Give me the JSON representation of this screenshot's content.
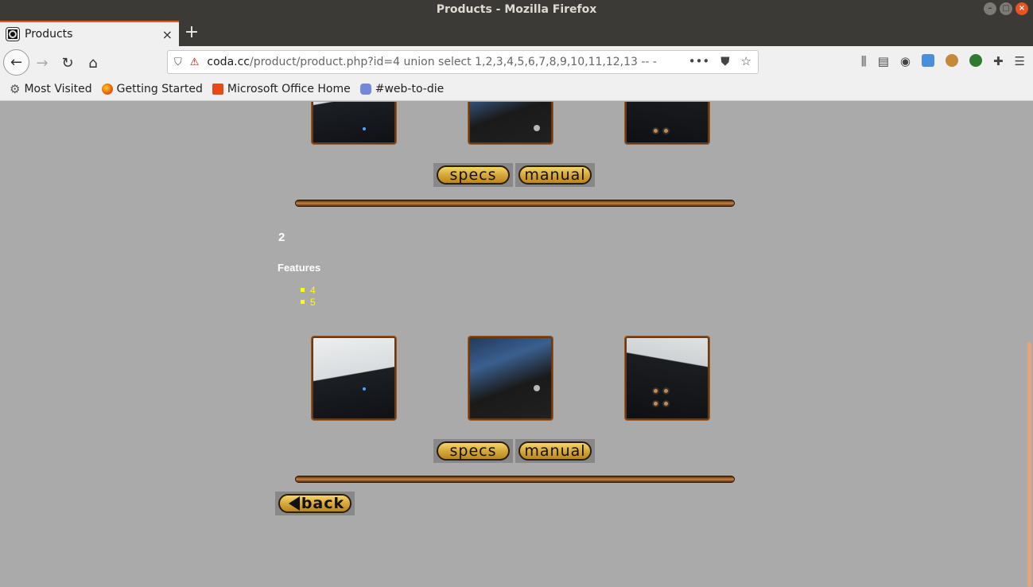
{
  "window": {
    "title": "Products - Mozilla Firefox"
  },
  "tab": {
    "title": "Products"
  },
  "url": {
    "host": "coda.cc",
    "path": "/product/product.php?id=4 union select 1,2,3,4,5,6,7,8,9,10,11,12,13 -- -"
  },
  "bookmarks": [
    "Most Visited",
    "Getting Started",
    "Microsoft Office Home",
    "#web-to-die"
  ],
  "content": {
    "heading_number": "2",
    "features_label": "Features",
    "features": [
      "4",
      "5"
    ],
    "specs_label": "specs",
    "manual_label": "manual",
    "back_label": "back"
  },
  "colors": {
    "page_bg": "#aaaaaa",
    "feature_text": "#ffff00",
    "accent": "#e95420"
  }
}
